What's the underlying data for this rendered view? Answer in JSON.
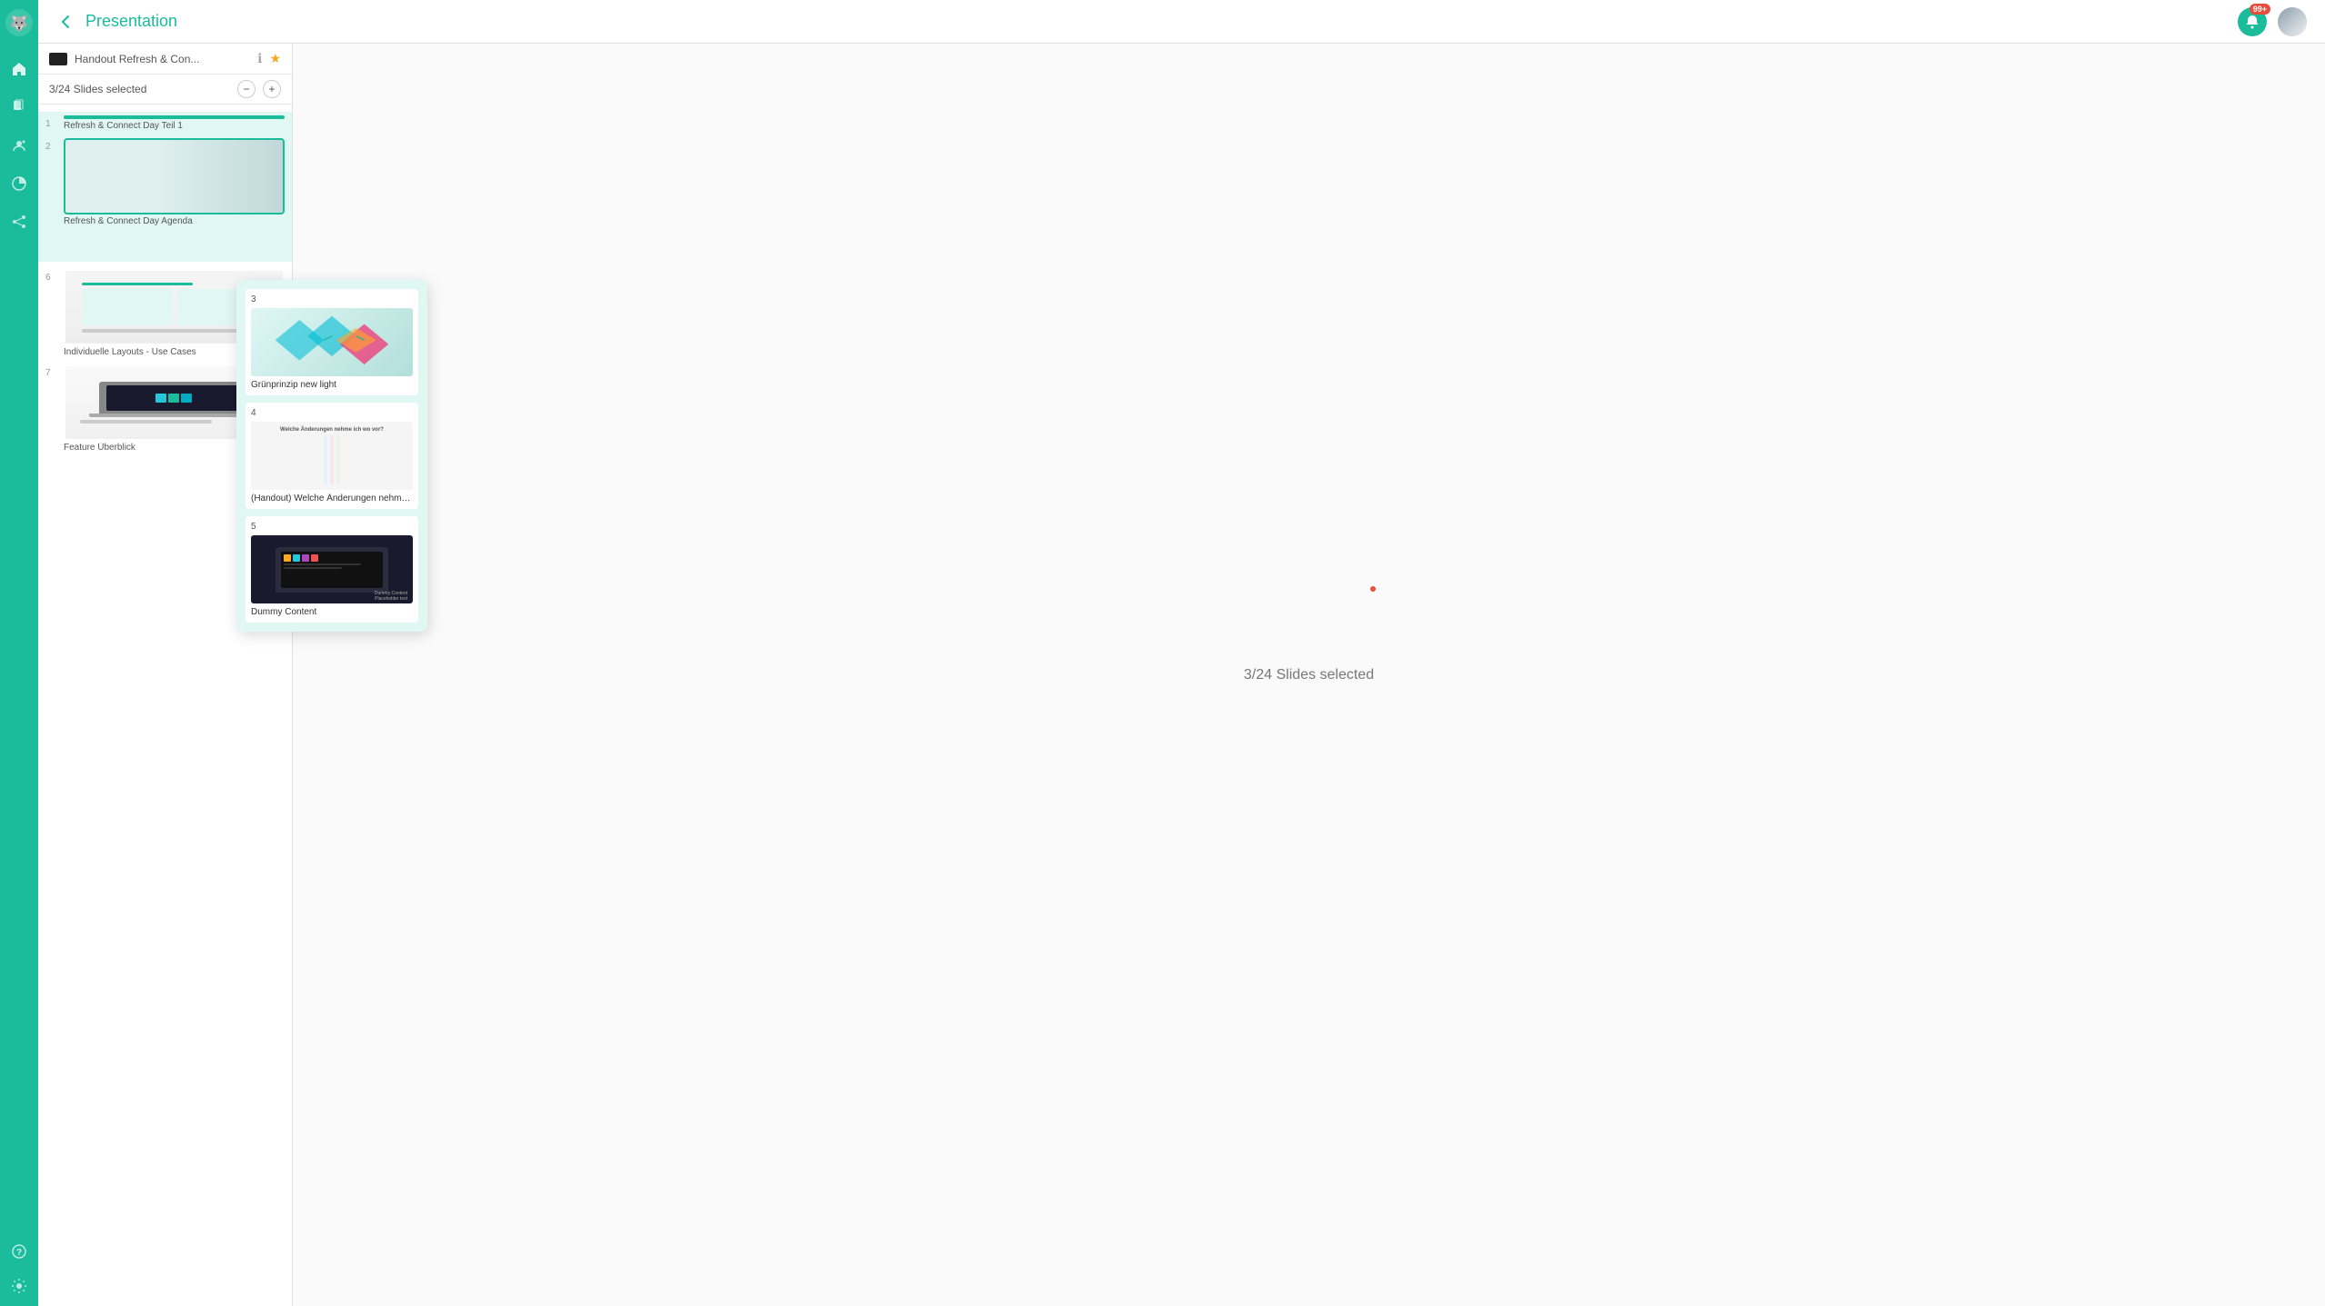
{
  "header": {
    "back_label": "←",
    "title": "Presentation",
    "notification_badge": "99+",
    "notification_icon": "🔔"
  },
  "sidebar": {
    "logo": "🐺",
    "nav_items": [
      {
        "icon": "⌂",
        "label": "Home",
        "active": false
      },
      {
        "icon": "▣",
        "label": "Files",
        "active": false
      },
      {
        "icon": "♟",
        "label": "Contacts",
        "active": false
      },
      {
        "icon": "◑",
        "label": "Analytics",
        "active": false
      },
      {
        "icon": "↗",
        "label": "Share",
        "active": false
      }
    ],
    "bottom_items": [
      {
        "icon": "?",
        "label": "Help"
      },
      {
        "icon": "⚙",
        "label": "Settings"
      }
    ]
  },
  "slides_panel": {
    "presentation_name": "Handout Refresh & Con...",
    "slides_count_label": "3/24 Slides selected",
    "minus_label": "−",
    "plus_label": "+",
    "slides": [
      {
        "num": "1",
        "label": "Refresh & Connect Day Teil 1",
        "selected": true,
        "type": "refresh_connect"
      },
      {
        "num": "2",
        "label": "Refresh & Connect Day Agenda",
        "selected": false,
        "type": "agenda"
      },
      {
        "num": "6",
        "label": "Individuelle Layouts - Use Cases",
        "selected": false,
        "type": "layouts"
      },
      {
        "num": "7",
        "label": "Feature Überblick",
        "selected": false,
        "type": "feature"
      }
    ]
  },
  "floating_popup": {
    "slides": [
      {
        "num": "3",
        "label": "Grünprinzip new light",
        "type": "gruenprinzip"
      },
      {
        "num": "4",
        "label": "(Handout) Welche Änderungen nehme i...",
        "type": "aenderungen"
      },
      {
        "num": "5",
        "label": "Dummy Content",
        "type": "dummy"
      }
    ]
  },
  "canvas": {
    "status_label": "3/24 Slides selected",
    "dot_color": "#e74c3c"
  }
}
